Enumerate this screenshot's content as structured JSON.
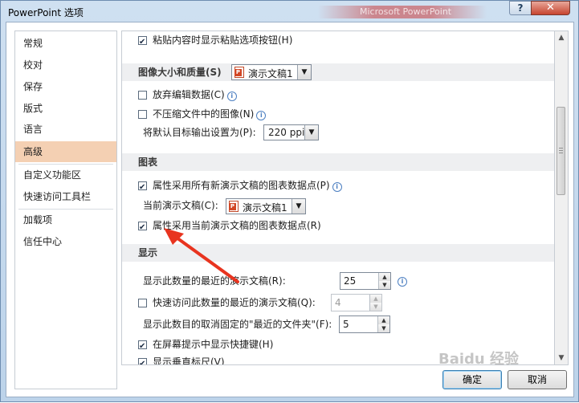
{
  "window": {
    "title": "PowerPoint 选项",
    "background_title": "Microsoft PowerPoint",
    "help_label": "?",
    "close_label": "✕"
  },
  "sidebar": {
    "items": [
      {
        "label": "常规"
      },
      {
        "label": "校对"
      },
      {
        "label": "保存"
      },
      {
        "label": "版式"
      },
      {
        "label": "语言"
      },
      {
        "label": "高级",
        "selected": true
      },
      {
        "label": "自定义功能区"
      },
      {
        "label": "快速访问工具栏"
      },
      {
        "label": "加载项"
      },
      {
        "label": "信任中心"
      }
    ]
  },
  "content": {
    "paste_button_option": {
      "label": "粘贴内容时显示粘贴选项按钮(H)",
      "checked": true
    },
    "image_section": {
      "title": "图像大小和质量(S)",
      "document_select": "演示文稿1",
      "discard_editing": {
        "label": "放弃编辑数据(C)",
        "checked": false
      },
      "no_compress": {
        "label": "不压缩文件中的图像(N)",
        "checked": false
      },
      "default_output_label": "将默认目标输出设置为(P):",
      "default_output_value": "220 ppi"
    },
    "chart_section": {
      "title": "图表",
      "all_docs_option": {
        "label": "属性采用所有新演示文稿的图表数据点(P)",
        "checked": true
      },
      "current_doc_label": "当前演示文稿(C):",
      "current_doc_select": "演示文稿1",
      "current_doc_option": {
        "label": "属性采用当前演示文稿的图表数据点(R)",
        "checked": true
      }
    },
    "display_section": {
      "title": "显示",
      "recent_docs_label": "显示此数量的最近的演示文稿(R):",
      "recent_docs_value": "25",
      "quick_access_option": {
        "label": "快速访问此数量的最近的演示文稿(Q):",
        "checked": false
      },
      "quick_access_value": "4",
      "unpinned_folders_label": "显示此数目的取消固定的\"最近的文件夹\"(F):",
      "unpinned_folders_value": "5",
      "screentip_shortcuts": {
        "label": "在屏幕提示中显示快捷键(H)",
        "checked": true
      },
      "vertical_ruler": {
        "label": "显示垂直标尺(V)",
        "checked": true
      }
    }
  },
  "footer": {
    "ok_label": "确定",
    "cancel_label": "取消"
  },
  "watermark": "Baidu 经验",
  "info_glyph": "i",
  "scroll": {
    "up_glyph": "▲",
    "down_glyph": "▼",
    "position_fraction": 0.35
  },
  "colors": {
    "selected_item": "#f4d0b3",
    "arrow": "#e8341f",
    "section_header": "#eeeff1"
  }
}
